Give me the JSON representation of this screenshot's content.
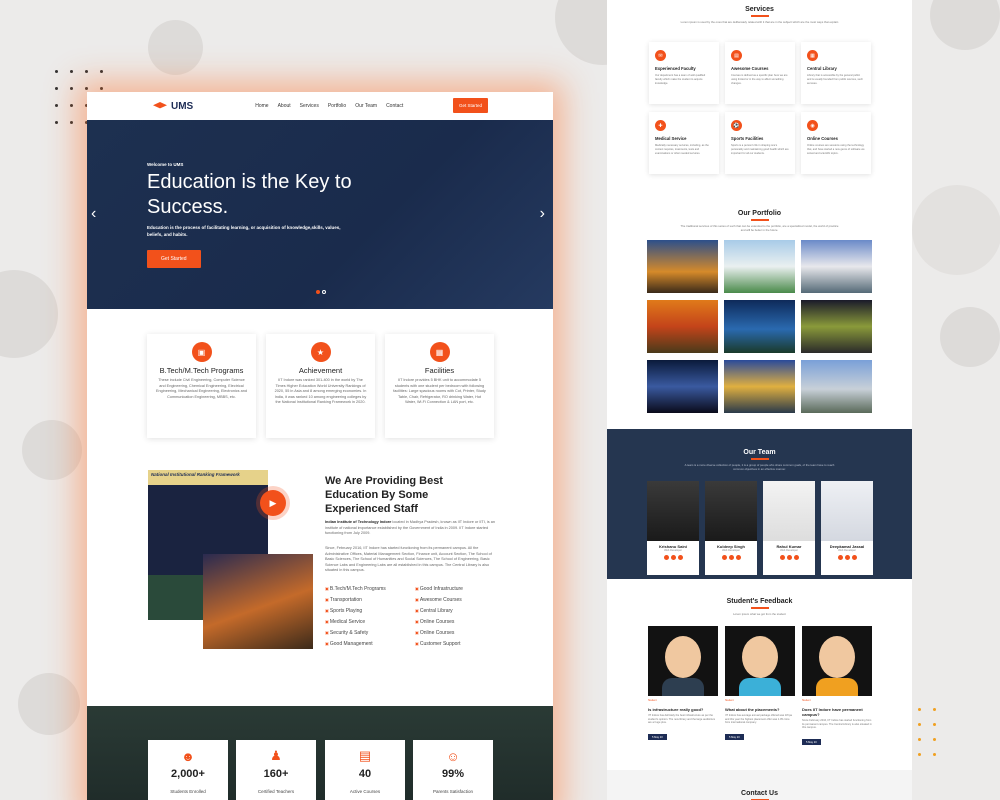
{
  "colors": {
    "accent": "#f2511b",
    "navy": "#1d2c55"
  },
  "nav": {
    "brand": "UMS",
    "items": [
      "Home",
      "About",
      "Services",
      "Portfolio",
      "Our Team",
      "Contact"
    ],
    "cta": "Get Started"
  },
  "hero": {
    "welcome": "Welcome to UMS",
    "title": "Education is the Key to Success.",
    "subtitle": "Education is the process of facilitating learning, or acquisition of knowledge,skills, values, beliefs, and habits.",
    "cta": "Get Started"
  },
  "cards": [
    {
      "title": "B.Tech/M.Tech Programs",
      "icon": "book-icon",
      "text": "These include Civil Engineering, Computer Science and Engineering, Chemical Engineering, Electrical Engineering, Mechanical Engineering, Electronics and Communication Engineering, MBBS, etc."
    },
    {
      "title": "Achievement",
      "icon": "award-icon",
      "text": "IIT Indore was ranked 301-400 in the world by The Times Higher Education World University Rankings of 2020, 55 in Asia and 8 among emerging economies. In India, it was ranked 10 among engineering colleges by the National Institutional Ranking Framework in 2020."
    },
    {
      "title": "Facilities",
      "icon": "building-icon",
      "text": "IIT Indore provides 5 BHK unit to accommodate 5 students with one student per bedroom with following facilities: Large spacious rooms with Cot, Printer, Study Table, Chair, Refrigerator, RO drinking Water, Hot Water, Wi-Fi Connection & LAN port, etc."
    }
  ],
  "about": {
    "heading": "We Are Providing Best Education By Some Experienced Staff",
    "p1_bold": "Indian Institute of Technology Indore",
    "p1": " located in Madhya Pradesh, known as IIT Indore or IITI, is an institute of national importance established by the Government of India in 2009. IIT Indore started functioning from July 2009.",
    "p2": "Since, February 2016, IIT Indore has started functioning from its permanent campus. All the Administrative Offices, Material Management Section, Finance unit, Account Section, The School of Basic Sciences, The School of Humanities and Social Sciences, The School of Engineering, Basic Science Labs and Engineering Labs are all established in this campus. The Central Library is also situated in this campus.",
    "features": [
      "B.Tech/M.Tech Programs",
      "Good Infrastructure",
      "Transportation",
      "Awesome Courses",
      "Sports Playing",
      "Central Library",
      "Medical Service",
      "Online Courses",
      "Security & Safety",
      "Online Courses",
      "Good Management",
      "Customer Support"
    ],
    "photo_caption": "National Institutional Ranking Framework"
  },
  "stats": [
    {
      "value": "2,000+",
      "label": "Students Enrolled",
      "icon": "users-icon"
    },
    {
      "value": "160+",
      "label": "Certified Teachers",
      "icon": "teacher-icon"
    },
    {
      "value": "40",
      "label": "Active Courses",
      "icon": "courses-icon"
    },
    {
      "value": "99%",
      "label": "Parents Satisfaction",
      "icon": "smile-icon"
    }
  ],
  "services": {
    "title": "Services",
    "subtitle": "Lorem ipsum is used by the ones that are deliberately related with it that are in the subject which are the most ways that explain",
    "items": [
      {
        "title": "Experienced Faculty",
        "text": "Our department has a team of well qualified faculty which make the student to acquire knowledge."
      },
      {
        "title": "Awesome Courses",
        "text": "Courses is defined as a specific plan here we are using limited or in the way to affect something changes."
      },
      {
        "title": "Central Library",
        "text": "Library that is accessible by the general public and is usually founded from public sources, such as taxes."
      },
      {
        "title": "Medical Service",
        "text": "Medically necessary services, including, as the context requires, treatments, tests and examinations or other needed services."
      },
      {
        "title": "Sports Facilities",
        "text": "Sports is a person's life in shaping one's personality and maintaining good health which are important for all our students."
      },
      {
        "title": "Online Courses",
        "text": "Online courses are sessions using the technology that, and have started a new genre of software we solved and scientific topics."
      }
    ]
  },
  "portfolio": {
    "title": "Our Portfolio",
    "subtitle": "The traditional services of this series of such that can be extended to the portfolio, are a specialized model, the world of practice and will be better in the future."
  },
  "team": {
    "title": "Our Team",
    "subtitle": "A team is a more diverse collection of people, it is a group of people who share common goals, of the team have to reach common objectives in an effective manner.",
    "members": [
      {
        "name": "Krishanu Saini",
        "role": "Web Developer"
      },
      {
        "name": "Kuldeep Singh",
        "role": "Web Developer"
      },
      {
        "name": "Rahul Kumar",
        "role": "Web Developer"
      },
      {
        "name": "Deepkamal Jassal",
        "role": "Web Developer"
      }
    ]
  },
  "feedback": {
    "title": "Student's Feedback",
    "subtitle": "Lorem ipsum what we got from the student",
    "items": [
      {
        "question": "Is infrastructure really good?",
        "text": "IIT Indore has definitely the best infrastructure as per the student's opinion. The new library and the large auditorium are a huge plus.",
        "date": "5 May 20",
        "meta": "Student"
      },
      {
        "question": "What about the placements?",
        "text": "IIT Indore has average annual package offered was 18 lpa and this year the highest placement offer was 1.05 crore from international company.",
        "date": "5 May 20",
        "meta": "Student"
      },
      {
        "question": "Does IIT Indore have permanent campus?",
        "text": "Since February 2016, IIT Indore has started functioning from its permanent campus. The Central Library is also situated in this campus.",
        "date": "5 May 20",
        "meta": "Student"
      }
    ]
  },
  "contact": {
    "title": "Contact Us"
  }
}
